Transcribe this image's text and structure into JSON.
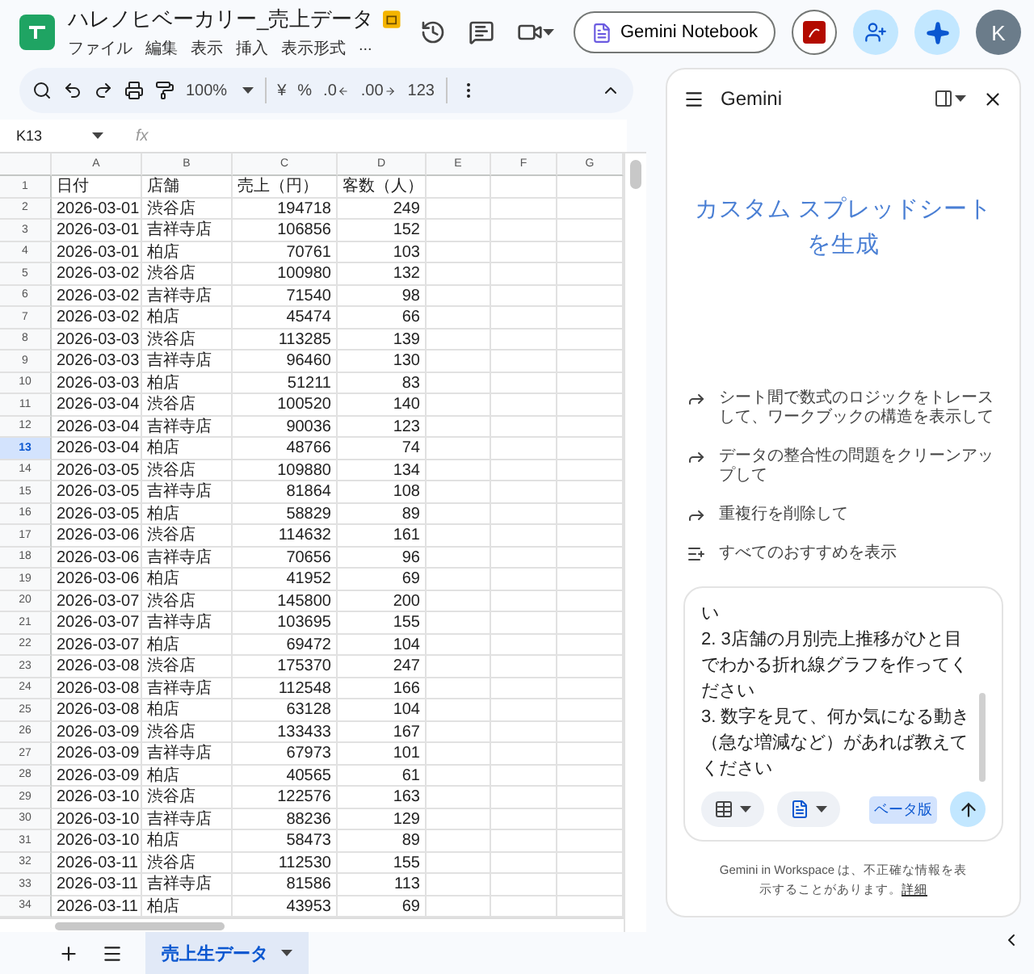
{
  "document": {
    "title": "ハレノヒベーカリー_売上データ",
    "menu": [
      "ファイル",
      "編集",
      "表示",
      "挿入",
      "表示形式",
      "..."
    ]
  },
  "header_actions": {
    "notebook_button": "Gemini Notebook",
    "avatar": "K"
  },
  "toolbar": {
    "zoom": "100%",
    "format_buttons": [
      {
        "label": "¥",
        "kind": "plain"
      },
      {
        "label": "%",
        "kind": "plain"
      },
      {
        "label": ".0",
        "kind": "decimal-less"
      },
      {
        "label": ".00",
        "kind": "decimal-more"
      },
      {
        "label": "123",
        "kind": "plain"
      }
    ]
  },
  "name_box": "K13",
  "formula_label": "fx",
  "table": {
    "columns": [
      {
        "label": "A"
      },
      {
        "label": "B",
        "numeric": false
      },
      {
        "label": "C",
        "numeric": true
      },
      {
        "label": "D",
        "numeric": true
      },
      {
        "label": "E"
      },
      {
        "label": "F"
      },
      {
        "label": "G"
      }
    ],
    "rows": [
      {
        "row": "1",
        "kind": "header",
        "selected": false,
        "cells": [
          "日付",
          "店舗",
          "売上（円）",
          "客数（人）"
        ]
      },
      {
        "row": "2",
        "kind": "data",
        "selected": false,
        "cells": [
          "2026-03-01",
          "渋谷店",
          "194718",
          "249"
        ]
      },
      {
        "row": "3",
        "kind": "data",
        "selected": false,
        "cells": [
          "2026-03-01",
          "吉祥寺店",
          "106856",
          "152"
        ]
      },
      {
        "row": "4",
        "kind": "data",
        "selected": false,
        "cells": [
          "2026-03-01",
          "柏店",
          "70761",
          "103"
        ]
      },
      {
        "row": "5",
        "kind": "data",
        "selected": false,
        "cells": [
          "2026-03-02",
          "渋谷店",
          "100980",
          "132"
        ]
      },
      {
        "row": "6",
        "kind": "data",
        "selected": false,
        "cells": [
          "2026-03-02",
          "吉祥寺店",
          "71540",
          "98"
        ]
      },
      {
        "row": "7",
        "kind": "data",
        "selected": false,
        "cells": [
          "2026-03-02",
          "柏店",
          "45474",
          "66"
        ]
      },
      {
        "row": "8",
        "kind": "data",
        "selected": false,
        "cells": [
          "2026-03-03",
          "渋谷店",
          "113285",
          "139"
        ]
      },
      {
        "row": "9",
        "kind": "data",
        "selected": false,
        "cells": [
          "2026-03-03",
          "吉祥寺店",
          "96460",
          "130"
        ]
      },
      {
        "row": "10",
        "kind": "data",
        "selected": false,
        "cells": [
          "2026-03-03",
          "柏店",
          "51211",
          "83"
        ]
      },
      {
        "row": "11",
        "kind": "data",
        "selected": false,
        "cells": [
          "2026-03-04",
          "渋谷店",
          "100520",
          "140"
        ]
      },
      {
        "row": "12",
        "kind": "data",
        "selected": false,
        "cells": [
          "2026-03-04",
          "吉祥寺店",
          "90036",
          "123"
        ]
      },
      {
        "row": "13",
        "kind": "data",
        "selected": true,
        "cells": [
          "2026-03-04",
          "柏店",
          "48766",
          "74"
        ]
      },
      {
        "row": "14",
        "kind": "data",
        "selected": false,
        "cells": [
          "2026-03-05",
          "渋谷店",
          "109880",
          "134"
        ]
      },
      {
        "row": "15",
        "kind": "data",
        "selected": false,
        "cells": [
          "2026-03-05",
          "吉祥寺店",
          "81864",
          "108"
        ]
      },
      {
        "row": "16",
        "kind": "data",
        "selected": false,
        "cells": [
          "2026-03-05",
          "柏店",
          "58829",
          "89"
        ]
      },
      {
        "row": "17",
        "kind": "data",
        "selected": false,
        "cells": [
          "2026-03-06",
          "渋谷店",
          "114632",
          "161"
        ]
      },
      {
        "row": "18",
        "kind": "data",
        "selected": false,
        "cells": [
          "2026-03-06",
          "吉祥寺店",
          "70656",
          "96"
        ]
      },
      {
        "row": "19",
        "kind": "data",
        "selected": false,
        "cells": [
          "2026-03-06",
          "柏店",
          "41952",
          "69"
        ]
      },
      {
        "row": "20",
        "kind": "data",
        "selected": false,
        "cells": [
          "2026-03-07",
          "渋谷店",
          "145800",
          "200"
        ]
      },
      {
        "row": "21",
        "kind": "data",
        "selected": false,
        "cells": [
          "2026-03-07",
          "吉祥寺店",
          "103695",
          "155"
        ]
      },
      {
        "row": "22",
        "kind": "data",
        "selected": false,
        "cells": [
          "2026-03-07",
          "柏店",
          "69472",
          "104"
        ]
      },
      {
        "row": "23",
        "kind": "data",
        "selected": false,
        "cells": [
          "2026-03-08",
          "渋谷店",
          "175370",
          "247"
        ]
      },
      {
        "row": "24",
        "kind": "data",
        "selected": false,
        "cells": [
          "2026-03-08",
          "吉祥寺店",
          "112548",
          "166"
        ]
      },
      {
        "row": "25",
        "kind": "data",
        "selected": false,
        "cells": [
          "2026-03-08",
          "柏店",
          "63128",
          "104"
        ]
      },
      {
        "row": "26",
        "kind": "data",
        "selected": false,
        "cells": [
          "2026-03-09",
          "渋谷店",
          "133433",
          "167"
        ]
      },
      {
        "row": "27",
        "kind": "data",
        "selected": false,
        "cells": [
          "2026-03-09",
          "吉祥寺店",
          "67973",
          "101"
        ]
      },
      {
        "row": "28",
        "kind": "data",
        "selected": false,
        "cells": [
          "2026-03-09",
          "柏店",
          "40565",
          "61"
        ]
      },
      {
        "row": "29",
        "kind": "data",
        "selected": false,
        "cells": [
          "2026-03-10",
          "渋谷店",
          "122576",
          "163"
        ]
      },
      {
        "row": "30",
        "kind": "data",
        "selected": false,
        "cells": [
          "2026-03-10",
          "吉祥寺店",
          "88236",
          "129"
        ]
      },
      {
        "row": "31",
        "kind": "data",
        "selected": false,
        "cells": [
          "2026-03-10",
          "柏店",
          "58473",
          "89"
        ]
      },
      {
        "row": "32",
        "kind": "data",
        "selected": false,
        "cells": [
          "2026-03-11",
          "渋谷店",
          "112530",
          "155"
        ]
      },
      {
        "row": "33",
        "kind": "data",
        "selected": false,
        "cells": [
          "2026-03-11",
          "吉祥寺店",
          "81586",
          "113"
        ]
      },
      {
        "row": "34",
        "kind": "data",
        "selected": false,
        "cells": [
          "2026-03-11",
          "柏店",
          "43953",
          "69"
        ]
      }
    ]
  },
  "sheet_tabs": [
    {
      "label": "売上生データ",
      "selected": true
    }
  ],
  "gemini": {
    "title": "Gemini",
    "heading": "カスタム スプレッドシートを生成",
    "suggestions": [
      {
        "text": "シート間で数式のロジックをトレースして、ワークブックの構造を表示して",
        "kind": "prompt"
      },
      {
        "text": "データの整合性の問題をクリーンアップして",
        "kind": "prompt"
      },
      {
        "text": "重複行を削除して",
        "kind": "prompt"
      },
      {
        "text": "すべてのおすすめを表示",
        "kind": "show-all"
      }
    ],
    "prompt_lines": [
      "い",
      "2. 3店舗の月別売上推移がひと目でわかる折れ線グラフを作ってください",
      "3. 数字を見て、何か気になる動き（急な増減など）があれば教えてください"
    ],
    "beta_badge": "ベータ版",
    "disclaimer": "Gemini in Workspace は、不正確な情報を表示することがあります。",
    "disclaimer_link": "詳細"
  }
}
